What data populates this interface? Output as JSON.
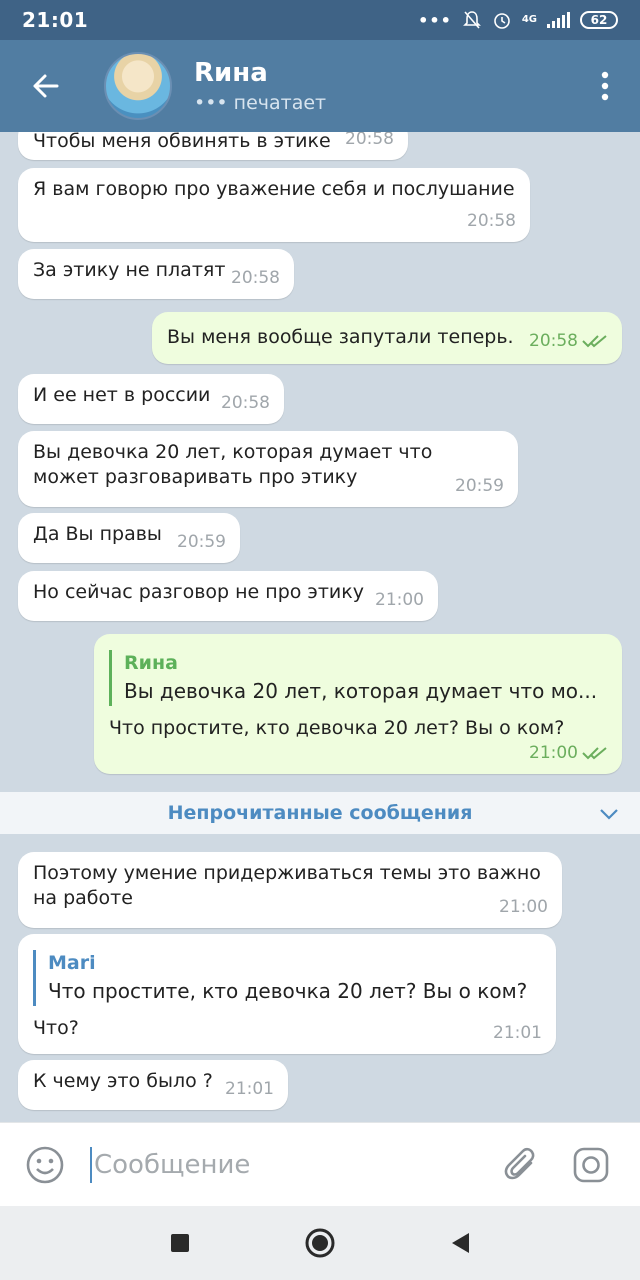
{
  "status_bar": {
    "time": "21:01",
    "network": "4G",
    "battery": "62"
  },
  "header": {
    "contact_name": "Rина",
    "typing_status": "печатает"
  },
  "messages": [
    {
      "text": "Чтобы меня обвинять в этике",
      "time": "20:58"
    },
    {
      "text": "Я вам говорю про уважение себя и послушание",
      "time": "20:58"
    },
    {
      "text": "За этику не платят",
      "time": "20:58"
    },
    {
      "text": "Вы меня вообще запутали теперь.",
      "time": "20:58"
    },
    {
      "text": "И ее нет в россии",
      "time": "20:58"
    },
    {
      "text": "Вы девочка 20 лет, которая думает что может разговаривать про этику",
      "time": "20:59"
    },
    {
      "text": "Да Вы правы",
      "time": "20:59"
    },
    {
      "text": "Но сейчас разговор не про этику",
      "time": "21:00"
    },
    {
      "reply_name": "Rина",
      "reply_text": "Вы девочка 20 лет, которая думает что мо...",
      "text": "Что простите, кто девочка 20 лет? Вы о ком?",
      "time": "21:00"
    },
    {
      "text": "Поэтому умение придерживаться темы это важно на работе",
      "time": "21:00"
    },
    {
      "reply_name": "Mari",
      "reply_text": "Что простите, кто девочка 20 лет? Вы о ком?",
      "text": "Что?",
      "time": "21:01"
    },
    {
      "text": "К чему это было ?",
      "time": "21:01"
    }
  ],
  "unread_label": "Непрочитанные сообщения",
  "input": {
    "placeholder": "Сообщение"
  },
  "colors": {
    "header": "#517da2",
    "status_bar": "#3f6386",
    "incoming": "#ffffff",
    "outgoing": "#effdde",
    "accent": "#4d8bc1",
    "outgoing_time": "#6bae5d"
  }
}
